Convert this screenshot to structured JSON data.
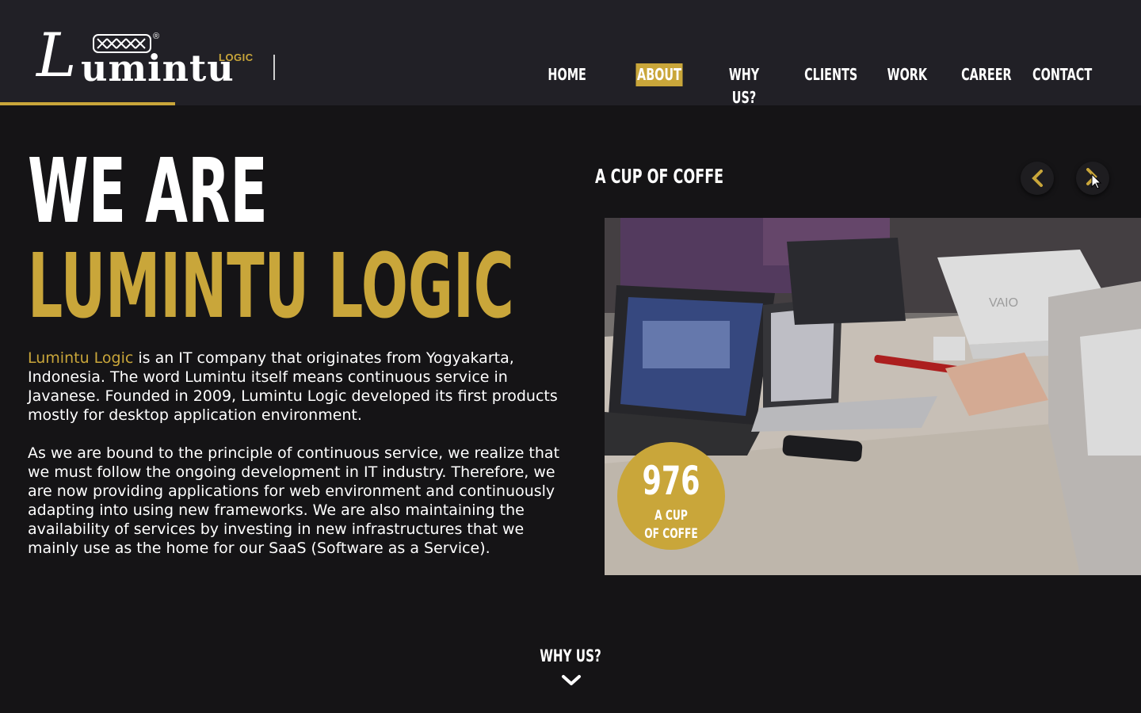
{
  "header": {
    "logo": {
      "wordmark": "Lumintu",
      "tag": "LOGIC",
      "registered": "®"
    },
    "nav": [
      {
        "label": "HOME",
        "active": false
      },
      {
        "label": "ABOUT",
        "active": true
      },
      {
        "label": "WHY US?",
        "active": false
      },
      {
        "label": "CLIENTS",
        "active": false
      },
      {
        "label": "WORK",
        "active": false
      },
      {
        "label": "CAREER",
        "active": false
      },
      {
        "label": "CONTACT",
        "active": false
      }
    ]
  },
  "hero": {
    "line1": "WE ARE",
    "line2": "LUMINTU LOGIC"
  },
  "about": {
    "brand": "Lumintu Logic",
    "para1_rest": " is an IT company that originates from Yogyakarta, Indonesia. The word Lumintu itself means continuous service in Javanese. Founded in 2009, Lumintu Logic developed its first products mostly for desktop application environment.",
    "para2": "As we are bound to the principle of continuous service, we realize that we must follow the ongoing development in IT industry. Therefore, we are now providing applications for web environment and continuously adapting into using new frameworks. We are also maintaining the availability of services by investing in new infrastructures that we mainly use as the home for our SaaS (Software as a Service)."
  },
  "slider": {
    "title": "A CUP OF COFFE",
    "prev_icon": "chevron-left-icon",
    "next_icon": "chevron-right-icon"
  },
  "counter": {
    "value": "976",
    "label_line1": "A CUP",
    "label_line2": "OF COFFE"
  },
  "scroll": {
    "label": "WHY US?",
    "icon": "chevron-down-icon"
  },
  "colors": {
    "accent": "#c9a63a",
    "background": "#151416",
    "header": "#212026"
  }
}
